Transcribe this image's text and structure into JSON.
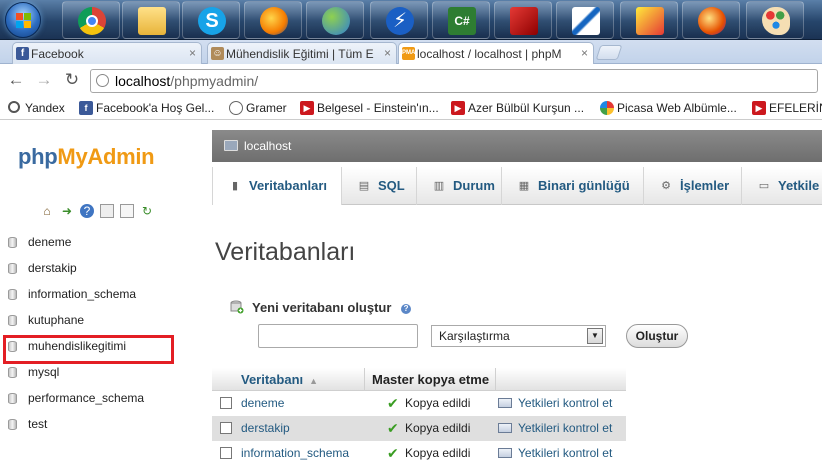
{
  "browser": {
    "tabs": [
      {
        "label": "Facebook",
        "favicon": "f"
      },
      {
        "label": "Mühendislik Eğitimi | Tüm E",
        "favicon": "user"
      },
      {
        "label": "localhost / localhost | phpM",
        "favicon": "pma"
      }
    ],
    "url": {
      "host": "localhost",
      "path": "/phpmyadmin/"
    },
    "bookmarks": [
      {
        "label": "Yandex"
      },
      {
        "label": "Facebook'a Hoş Gel..."
      },
      {
        "label": "Gramer"
      },
      {
        "label": "Belgesel - Einstein'ın..."
      },
      {
        "label": "Azer Bülbül Kurşun ..."
      },
      {
        "label": "Picasa Web Albümle..."
      },
      {
        "label": "EFELERİN"
      }
    ]
  },
  "pma": {
    "logo": {
      "part1": "php",
      "part2": "MyAdmin"
    },
    "databases": [
      "deneme",
      "derstakip",
      "information_schema",
      "kutuphane",
      "muhendislikegitimi",
      "mysql",
      "performance_schema",
      "test"
    ],
    "server_label": "localhost",
    "tabs": [
      {
        "label": "Veritabanları",
        "icon": "database-icon"
      },
      {
        "label": "SQL",
        "icon": "sql-icon"
      },
      {
        "label": "Durum",
        "icon": "status-icon"
      },
      {
        "label": "Binari günlüğü",
        "icon": "binlog-icon"
      },
      {
        "label": "İşlemler",
        "icon": "gear-icon"
      },
      {
        "label": "Yetkile",
        "icon": "privileges-icon"
      }
    ],
    "heading": "Veritabanları",
    "create": {
      "label": "Yeni veritabanı oluştur",
      "collation_placeholder": "Karşılaştırma",
      "button": "Oluştur"
    },
    "table": {
      "col_db": "Veritabanı",
      "col_master": "Master kopya etme",
      "rows": [
        {
          "name": "deneme",
          "replication": "Kopya edildi",
          "privileges": "Yetkileri kontrol et"
        },
        {
          "name": "derstakip",
          "replication": "Kopya edildi",
          "privileges": "Yetkileri kontrol et"
        },
        {
          "name": "information_schema",
          "replication": "Kopya edildi",
          "privileges": "Yetkileri kontrol et"
        }
      ]
    }
  },
  "colors": {
    "highlight": "#e31e24",
    "link": "#235a81",
    "logo_blue": "#3a6aa0",
    "logo_orange": "#f09a14"
  }
}
